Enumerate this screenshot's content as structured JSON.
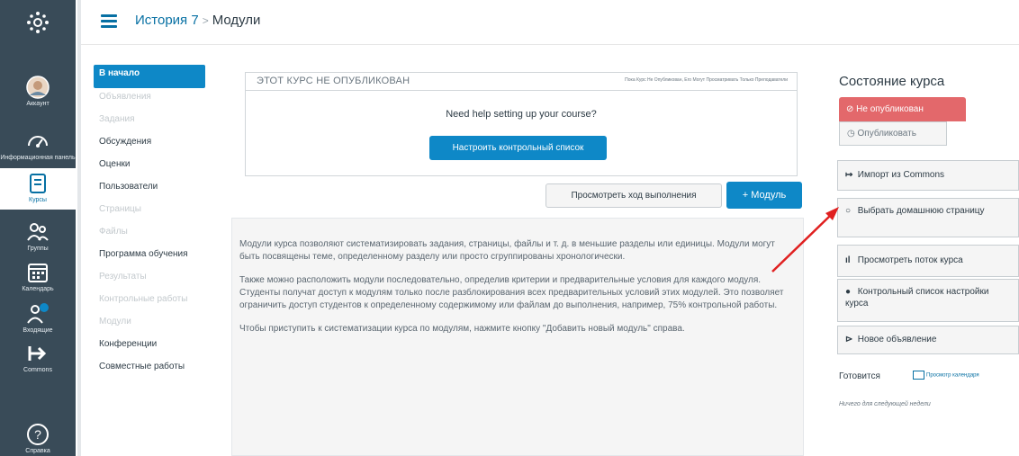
{
  "globalnav": {
    "items": [
      {
        "label": "",
        "icon": "logo-icon"
      },
      {
        "label": "Аккаунт",
        "icon": "avatar"
      },
      {
        "label": "Информационная панель",
        "icon": "dashboard-icon"
      },
      {
        "label": "Курсы",
        "icon": "courses-icon"
      },
      {
        "label": "Группы",
        "icon": "groups-icon"
      },
      {
        "label": "Календарь",
        "icon": "calendar-icon"
      },
      {
        "label": "Входящие",
        "icon": "inbox-icon"
      },
      {
        "label": "Commons",
        "icon": "commons-icon"
      },
      {
        "label": "Справка",
        "icon": "help-icon"
      }
    ]
  },
  "header": {
    "course": "История 7",
    "separator": ">",
    "current": "Модули"
  },
  "coursenav": {
    "items": [
      {
        "label": "В начало",
        "state": "active"
      },
      {
        "label": "Объявления",
        "state": "dim"
      },
      {
        "label": "Задания",
        "state": "dim"
      },
      {
        "label": "Обсуждения",
        "state": "normal"
      },
      {
        "label": "Оценки",
        "state": "normal"
      },
      {
        "label": "Пользователи",
        "state": "normal"
      },
      {
        "label": "Страницы",
        "state": "dim"
      },
      {
        "label": "Файлы",
        "state": "dim"
      },
      {
        "label": "Программа обучения",
        "state": "normal"
      },
      {
        "label": "Результаты",
        "state": "dim"
      },
      {
        "label": "Контрольные работы",
        "state": "dim"
      },
      {
        "label": "Модули",
        "state": "dim"
      },
      {
        "label": "Конференции",
        "state": "normal"
      },
      {
        "label": "Совместные работы",
        "state": "normal"
      }
    ]
  },
  "banner": {
    "title": "ЭТОТ КУРС НЕ ОПУБЛИКОВАН",
    "note": "Пока Курс Не Опубликован, Его Могут Просматривать Только Преподаватели",
    "help": "Need help setting up your course?",
    "setup_button": "Настроить контрольный список"
  },
  "actions": {
    "progress_button": "Просмотреть ход выполнения",
    "add_module_button": "+ Модуль"
  },
  "info": {
    "p1": "Модули курса позволяют систематизировать задания, страницы, файлы и т. д. в меньшие разделы или единицы. Модули могут быть посвящены теме, определенному разделу или просто сгруппированы хронологически.",
    "p2": "Также можно расположить модули последовательно, определив критерии и предварительные условия для каждого модуля. Студенты получат доступ к модулям только после разблокирования всех предварительных условий этих модулей. Это позволяет ограничить доступ студентов к определенному содержимому или файлам до выполнения, например, 75% контрольной работы.",
    "p3": "Чтобы приступить к систематизации курса по модулям, нажмите кнопку \"Добавить новый модуль\" справа."
  },
  "sidebar": {
    "status_title": "Состояние курса",
    "unpublished": "Не опубликован",
    "publish": "Опубликовать",
    "import": "Импорт из Commons",
    "choose_home": "Выбрать домашнюю страницу",
    "stream": "Просмотреть поток курса",
    "checklist": "Контрольный список настройки курса",
    "announcement": "Новое объявление",
    "coming_up": "Готовится",
    "view_calendar": "Просмотр календаря",
    "nothing": "Ничего для следующей недели"
  },
  "colors": {
    "nav_bg": "#394b58",
    "accent": "#0e88c7",
    "danger": "#e0585b",
    "arrow": "#e02020"
  }
}
